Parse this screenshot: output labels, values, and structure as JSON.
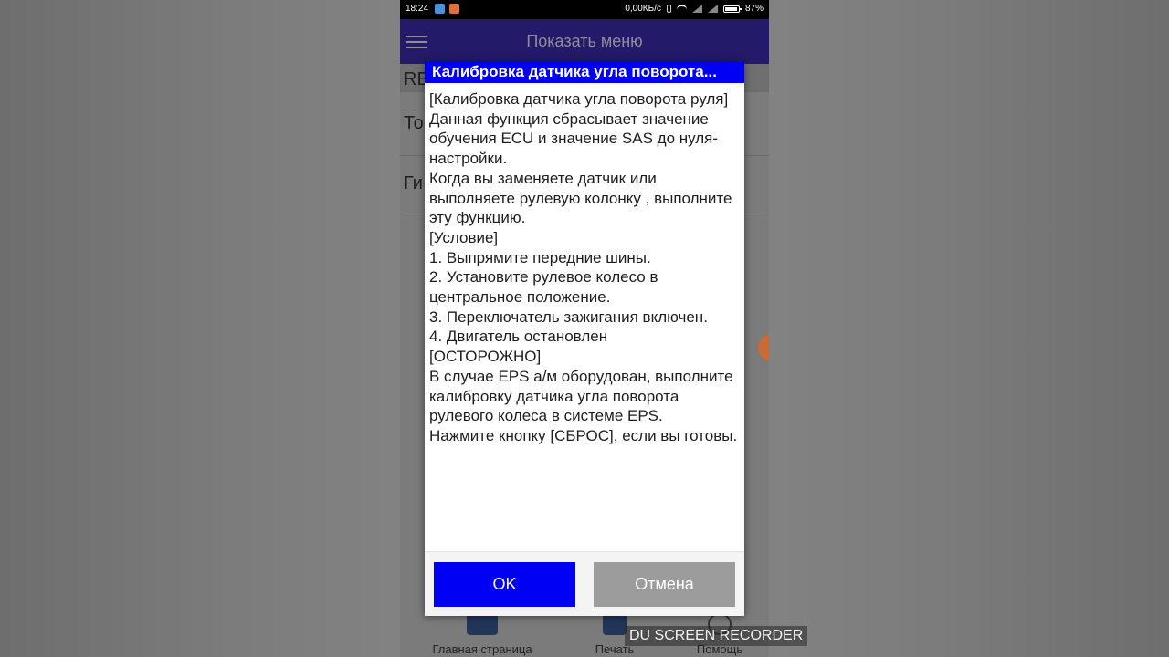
{
  "status_bar": {
    "time": "18:24",
    "network_speed": "0,00КБ/с",
    "battery_percent": "87%",
    "icons": [
      "bluetooth-icon",
      "wifi-icon",
      "signal-icon",
      "battery-icon"
    ]
  },
  "app_bar": {
    "title": "Показать меню",
    "menu_icon": "hamburger-icon"
  },
  "background_list": {
    "items": [
      "RE",
      "То",
      "Ги"
    ]
  },
  "dialog": {
    "title": "Калибровка датчика угла поворота...",
    "body": "[Калибровка датчика угла поворота руля]\n Данная функция сбрасывает значение обучения ECU и значение SAS до нуля-настройки.\n Когда вы заменяете датчик или выполняете рулевую колонку , выполните эту функцию.\n [Условие]\n 1. Выпрямите передние шины.\n 2. Установите рулевое колесо в центральное положение.\n 3. Переключатель зажигания включен.\n 4. Двигатель остановлен\n[ОСТОРОЖНО]\n В случае EPS а/м оборудован, выполните калибровку датчика угла поворота рулевого колеса в системе EPS.\n Нажмите кнопку [СБРОС], если вы готовы.",
    "ok_label": "OK",
    "cancel_label": "Отмена"
  },
  "bottom_nav": {
    "home_label": "Главная страница",
    "print_label": "Печать",
    "help_label": "Помощь"
  },
  "watermark": "DU SCREEN RECORDER",
  "colors": {
    "dialog_title_bg": "#0000f5",
    "ok_button": "#0000f5",
    "cancel_button": "#9c9c9c",
    "app_bar": "#241a6a"
  }
}
